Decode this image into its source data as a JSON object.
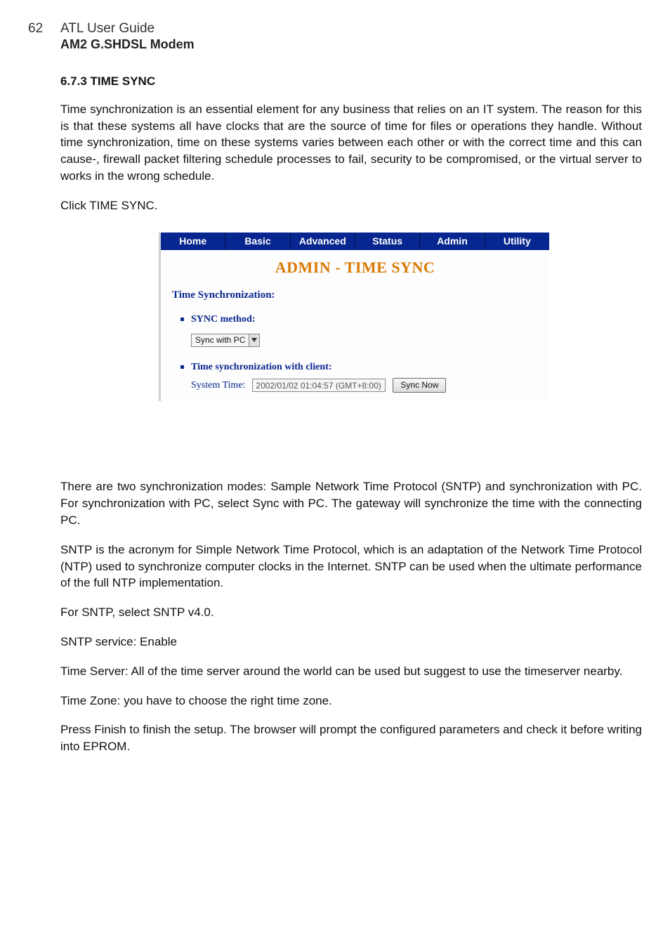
{
  "page_number": "62",
  "doc_title": "ATL User Guide",
  "doc_subtitle": "AM2 G.SHDSL Modem",
  "section_heading": "6.7.3  TIME SYNC",
  "para1": "Time synchronization is an essential element for any business that relies on an IT system. The reason for this is that these systems all have clocks that are the source of time for files or operations they handle. Without time synchronization, time on these systems varies between each other or with the correct time and this can cause-, firewall packet filtering schedule processes to fail, security to be compromised, or the virtual server to works in the wrong schedule.",
  "para2": "Click TIME SYNC.",
  "screenshot": {
    "tabs": [
      "Home",
      "Basic",
      "Advanced",
      "Status",
      "Admin",
      "Utility"
    ],
    "panel_title": "ADMIN - TIME SYNC",
    "subheading": "Time Synchronization:",
    "sync_method_label": "SYNC method:",
    "sync_method_value": "Sync with PC",
    "client_label": "Time synchronization with client:",
    "system_time_label": "System Time:",
    "system_time_value": "2002/01/02 01:04:57 (GMT+8:00)",
    "sync_now_button": "Sync Now"
  },
  "para3": "There are two synchronization modes: Sample Network Time Protocol (SNTP) and synchronization with PC. For synchronization with PC, select Sync with PC. The gateway will synchronize the time with the connecting PC.",
  "para4": "SNTP is the acronym for Simple Network Time Protocol, which is an adaptation of the Network Time Protocol (NTP) used to synchronize computer clocks in the Internet. SNTP can be used when the ultimate performance of the full NTP implementation.",
  "para5": "For SNTP, select SNTP v4.0.",
  "para6": "SNTP service: Enable",
  "para7": "Time Server: All of the time server around the world can be used but suggest to use the timeserver nearby.",
  "para8": "Time Zone: you have to choose the right time zone.",
  "para9": "Press Finish to finish the setup. The browser will prompt the configured parameters and check it before writing into EPROM."
}
